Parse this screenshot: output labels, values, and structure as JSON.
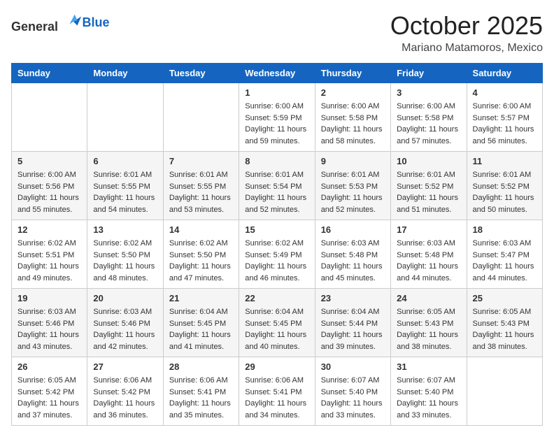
{
  "logo": {
    "text_general": "General",
    "text_blue": "Blue"
  },
  "title": "October 2025",
  "subtitle": "Mariano Matamoros, Mexico",
  "headers": [
    "Sunday",
    "Monday",
    "Tuesday",
    "Wednesday",
    "Thursday",
    "Friday",
    "Saturday"
  ],
  "weeks": [
    [
      {
        "day": "",
        "content": ""
      },
      {
        "day": "",
        "content": ""
      },
      {
        "day": "",
        "content": ""
      },
      {
        "day": "1",
        "content": "Sunrise: 6:00 AM\nSunset: 5:59 PM\nDaylight: 11 hours\nand 59 minutes."
      },
      {
        "day": "2",
        "content": "Sunrise: 6:00 AM\nSunset: 5:58 PM\nDaylight: 11 hours\nand 58 minutes."
      },
      {
        "day": "3",
        "content": "Sunrise: 6:00 AM\nSunset: 5:58 PM\nDaylight: 11 hours\nand 57 minutes."
      },
      {
        "day": "4",
        "content": "Sunrise: 6:00 AM\nSunset: 5:57 PM\nDaylight: 11 hours\nand 56 minutes."
      }
    ],
    [
      {
        "day": "5",
        "content": "Sunrise: 6:00 AM\nSunset: 5:56 PM\nDaylight: 11 hours\nand 55 minutes."
      },
      {
        "day": "6",
        "content": "Sunrise: 6:01 AM\nSunset: 5:55 PM\nDaylight: 11 hours\nand 54 minutes."
      },
      {
        "day": "7",
        "content": "Sunrise: 6:01 AM\nSunset: 5:55 PM\nDaylight: 11 hours\nand 53 minutes."
      },
      {
        "day": "8",
        "content": "Sunrise: 6:01 AM\nSunset: 5:54 PM\nDaylight: 11 hours\nand 52 minutes."
      },
      {
        "day": "9",
        "content": "Sunrise: 6:01 AM\nSunset: 5:53 PM\nDaylight: 11 hours\nand 52 minutes."
      },
      {
        "day": "10",
        "content": "Sunrise: 6:01 AM\nSunset: 5:52 PM\nDaylight: 11 hours\nand 51 minutes."
      },
      {
        "day": "11",
        "content": "Sunrise: 6:01 AM\nSunset: 5:52 PM\nDaylight: 11 hours\nand 50 minutes."
      }
    ],
    [
      {
        "day": "12",
        "content": "Sunrise: 6:02 AM\nSunset: 5:51 PM\nDaylight: 11 hours\nand 49 minutes."
      },
      {
        "day": "13",
        "content": "Sunrise: 6:02 AM\nSunset: 5:50 PM\nDaylight: 11 hours\nand 48 minutes."
      },
      {
        "day": "14",
        "content": "Sunrise: 6:02 AM\nSunset: 5:50 PM\nDaylight: 11 hours\nand 47 minutes."
      },
      {
        "day": "15",
        "content": "Sunrise: 6:02 AM\nSunset: 5:49 PM\nDaylight: 11 hours\nand 46 minutes."
      },
      {
        "day": "16",
        "content": "Sunrise: 6:03 AM\nSunset: 5:48 PM\nDaylight: 11 hours\nand 45 minutes."
      },
      {
        "day": "17",
        "content": "Sunrise: 6:03 AM\nSunset: 5:48 PM\nDaylight: 11 hours\nand 44 minutes."
      },
      {
        "day": "18",
        "content": "Sunrise: 6:03 AM\nSunset: 5:47 PM\nDaylight: 11 hours\nand 44 minutes."
      }
    ],
    [
      {
        "day": "19",
        "content": "Sunrise: 6:03 AM\nSunset: 5:46 PM\nDaylight: 11 hours\nand 43 minutes."
      },
      {
        "day": "20",
        "content": "Sunrise: 6:03 AM\nSunset: 5:46 PM\nDaylight: 11 hours\nand 42 minutes."
      },
      {
        "day": "21",
        "content": "Sunrise: 6:04 AM\nSunset: 5:45 PM\nDaylight: 11 hours\nand 41 minutes."
      },
      {
        "day": "22",
        "content": "Sunrise: 6:04 AM\nSunset: 5:45 PM\nDaylight: 11 hours\nand 40 minutes."
      },
      {
        "day": "23",
        "content": "Sunrise: 6:04 AM\nSunset: 5:44 PM\nDaylight: 11 hours\nand 39 minutes."
      },
      {
        "day": "24",
        "content": "Sunrise: 6:05 AM\nSunset: 5:43 PM\nDaylight: 11 hours\nand 38 minutes."
      },
      {
        "day": "25",
        "content": "Sunrise: 6:05 AM\nSunset: 5:43 PM\nDaylight: 11 hours\nand 38 minutes."
      }
    ],
    [
      {
        "day": "26",
        "content": "Sunrise: 6:05 AM\nSunset: 5:42 PM\nDaylight: 11 hours\nand 37 minutes."
      },
      {
        "day": "27",
        "content": "Sunrise: 6:06 AM\nSunset: 5:42 PM\nDaylight: 11 hours\nand 36 minutes."
      },
      {
        "day": "28",
        "content": "Sunrise: 6:06 AM\nSunset: 5:41 PM\nDaylight: 11 hours\nand 35 minutes."
      },
      {
        "day": "29",
        "content": "Sunrise: 6:06 AM\nSunset: 5:41 PM\nDaylight: 11 hours\nand 34 minutes."
      },
      {
        "day": "30",
        "content": "Sunrise: 6:07 AM\nSunset: 5:40 PM\nDaylight: 11 hours\nand 33 minutes."
      },
      {
        "day": "31",
        "content": "Sunrise: 6:07 AM\nSunset: 5:40 PM\nDaylight: 11 hours\nand 33 minutes."
      },
      {
        "day": "",
        "content": ""
      }
    ]
  ]
}
